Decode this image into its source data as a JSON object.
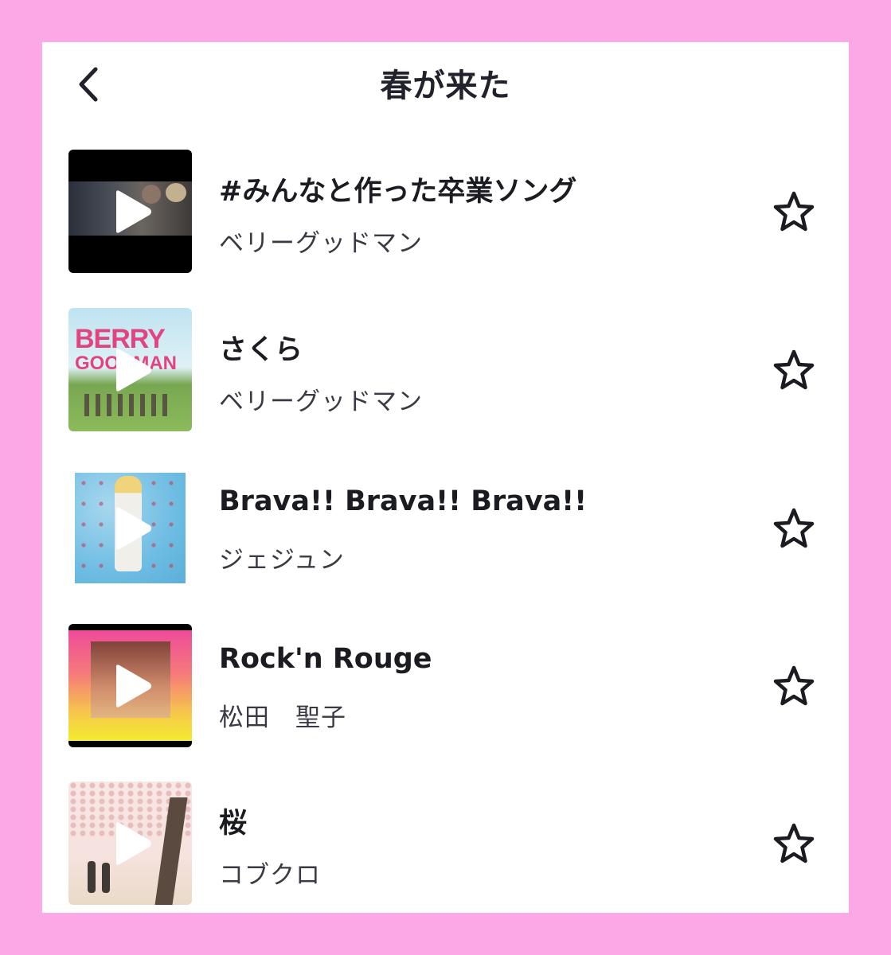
{
  "header": {
    "back_icon": "chevron-left-icon",
    "title": "春が来た"
  },
  "songs": [
    {
      "title": "#みんなと作った卒業ソング",
      "artist": "ベリーグッドマン",
      "favorite_icon": "star-outline-icon"
    },
    {
      "title": "さくら",
      "artist": "ベリーグッドマン",
      "favorite_icon": "star-outline-icon",
      "cover_text": [
        "BERRY",
        "GOODMAN"
      ]
    },
    {
      "title": "Brava!! Brava!! Brava!!",
      "artist": "ジェジュン",
      "favorite_icon": "star-outline-icon"
    },
    {
      "title": "Rock'n Rouge",
      "artist": "松田　聖子",
      "favorite_icon": "star-outline-icon"
    },
    {
      "title": "桜",
      "artist": "コブクロ",
      "favorite_icon": "star-outline-icon"
    }
  ],
  "colors": {
    "page_background": "#fca8e6",
    "panel_background": "#ffffff",
    "text_primary": "#1b1b22",
    "play_icon": "#ffffff"
  }
}
